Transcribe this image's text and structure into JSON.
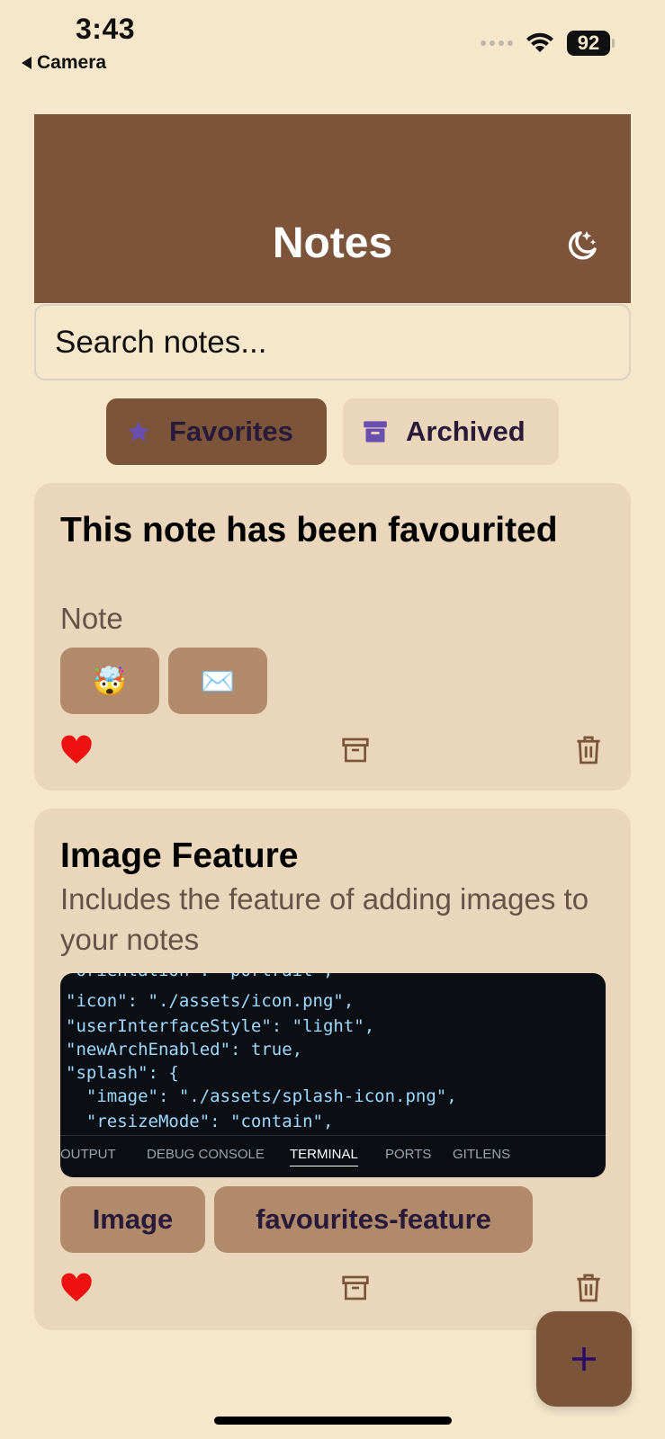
{
  "status_bar": {
    "time": "3:43",
    "back_label": "Camera",
    "battery": "92"
  },
  "header": {
    "title": "Notes"
  },
  "search": {
    "placeholder": "Search notes..."
  },
  "filters": {
    "favorites_label": "Favorites",
    "archived_label": "Archived"
  },
  "notes": [
    {
      "title": "This note has been favourited",
      "body": "Note",
      "tags": [
        "🤯",
        "✉️"
      ],
      "favorited": true
    },
    {
      "title": "Image Feature",
      "body": "Includes the feature of adding images to your notes",
      "tags": [
        "Image",
        "favourites-feature"
      ],
      "favorited": true,
      "image": {
        "code_lines": [
          "\"orientation\": \"portrait\",",
          "\"icon\": \"./assets/icon.png\",",
          "\"userInterfaceStyle\": \"light\",",
          "\"newArchEnabled\": true,",
          "\"splash\": {",
          "  \"image\": \"./assets/splash-icon.png\",",
          "  \"resizeMode\": \"contain\","
        ],
        "panel_tabs": [
          "OUTPUT",
          "DEBUG CONSOLE",
          "TERMINAL",
          "PORTS",
          "GITLENS"
        ],
        "active_tab": "TERMINAL"
      }
    }
  ],
  "colors": {
    "background": "#f6e7cb",
    "header": "#7b5439",
    "card": "#ead7bb",
    "tag": "#b08a6b",
    "heart": "#ee1111",
    "accent_icon": "#6b4fb0"
  },
  "icons": {
    "theme": "moon-stars-icon",
    "favorites": "star-icon",
    "archived": "archive-box-icon",
    "fab": "plus-icon"
  }
}
